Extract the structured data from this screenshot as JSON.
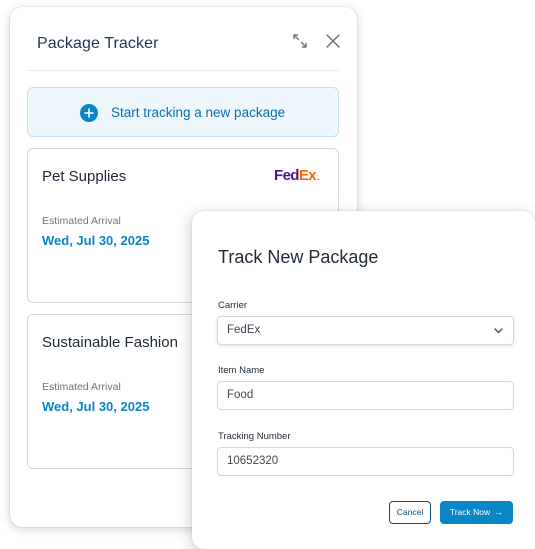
{
  "tracker": {
    "title": "Package Tracker",
    "start_label": "Start tracking a new package",
    "packages": [
      {
        "name": "Pet Supplies",
        "carrier_logo_text": [
          "Fed",
          "Ex",
          "."
        ],
        "estimated_label": "Estimated Arrival",
        "estimated_date": "Wed, Jul 30, 2025"
      },
      {
        "name": "Sustainable Fashion",
        "estimated_label": "Estimated Arrival",
        "estimated_date": "Wed, Jul 30, 2025"
      }
    ]
  },
  "dialog": {
    "title": "Track New Package",
    "carrier_label": "Carrier",
    "carrier_value": "FedEx",
    "item_label": "Item Name",
    "item_value": "Food",
    "tracking_label": "Tracking Number",
    "tracking_value": "10652320",
    "cancel_label": "Cancel",
    "track_label": "Track Now",
    "track_arrow": "→"
  },
  "colors": {
    "accent": "#0a86c7",
    "title_navy": "#1d3557",
    "fedex_purple": "#4d148c",
    "fedex_orange": "#ff6600"
  },
  "icons": [
    "expand-icon",
    "close-icon",
    "plus-icon",
    "chevron-down-icon",
    "arrow-right-icon"
  ]
}
